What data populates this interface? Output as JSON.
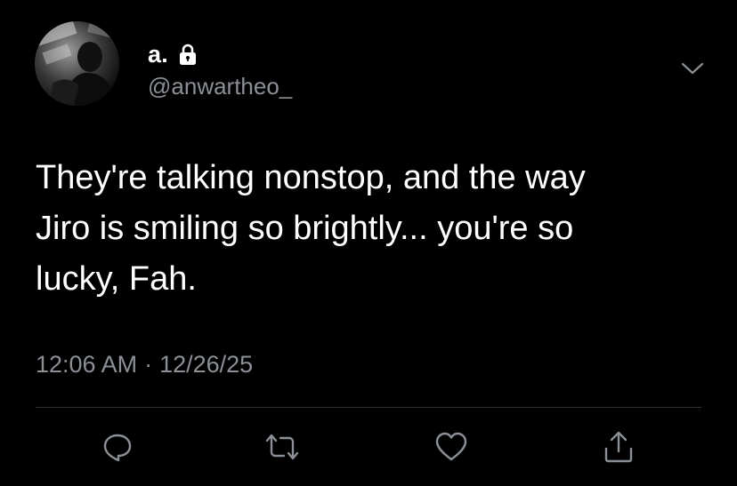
{
  "user": {
    "display_name": "a.",
    "handle": "@anwartheo_",
    "protected_icon": "lock-icon",
    "avatar": "profile-photo"
  },
  "tweet": {
    "text": "They're talking nonstop, and the way\nJiro is smiling so brightly... you're so\nlucky, Fah.",
    "time": "12:06 AM",
    "separator": "·",
    "date": "12/26/25"
  },
  "actions": [
    {
      "name": "reply",
      "icon": "reply-icon"
    },
    {
      "name": "retweet",
      "icon": "retweet-icon"
    },
    {
      "name": "like",
      "icon": "heart-icon"
    },
    {
      "name": "share",
      "icon": "share-icon"
    }
  ],
  "menu": {
    "icon": "chevron-down-icon"
  },
  "colors": {
    "background": "#000000",
    "text": "#ffffff",
    "secondary": "#8b9096",
    "divider": "#2f3336",
    "icon": "#8b9096"
  }
}
